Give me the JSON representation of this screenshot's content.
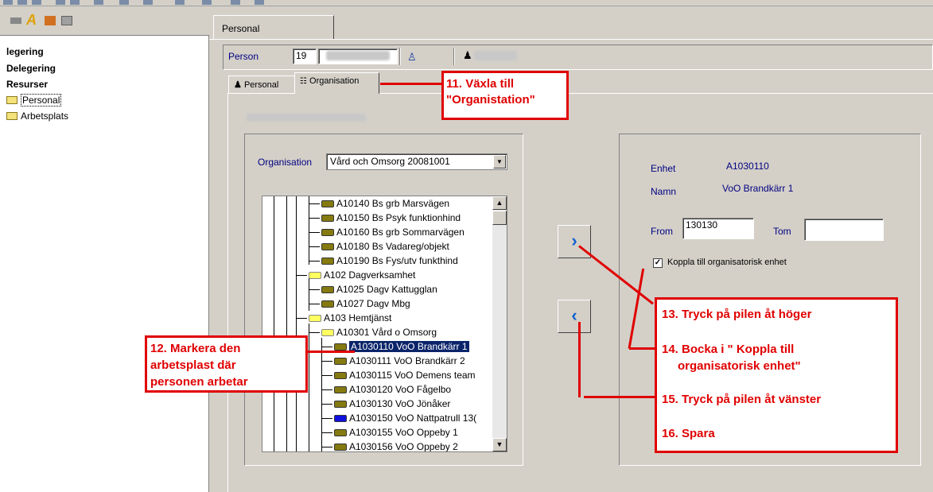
{
  "left_tree": {
    "items": [
      {
        "label": "legering",
        "bold": true
      },
      {
        "label": "Delegering",
        "bold": true
      },
      {
        "label": "Resurser",
        "bold": true
      },
      {
        "label": "Personal",
        "folder": true
      },
      {
        "label": "Arbetsplats",
        "folder": true
      }
    ]
  },
  "top_tab": {
    "label": "Personal"
  },
  "person": {
    "label": "Person",
    "id_prefix": "19"
  },
  "inner_tabs": {
    "personal": "Personal",
    "organisation": "Organisation"
  },
  "org": {
    "label": "Organisation",
    "selected": "Vård och Omsorg 20081001"
  },
  "tree": [
    {
      "code": "A10140",
      "name": "Bs grb Marsvägen",
      "icon": "olive"
    },
    {
      "code": "A10150",
      "name": "Bs Psyk funktionhind",
      "icon": "olive"
    },
    {
      "code": "A10160",
      "name": "Bs grb Sommarvägen",
      "icon": "olive"
    },
    {
      "code": "A10180",
      "name": "Bs Vadareg/objekt",
      "icon": "olive"
    },
    {
      "code": "A10190",
      "name": "Bs Fys/utv funkthind",
      "icon": "olive"
    },
    {
      "code": "A102",
      "name": "Dagverksamhet",
      "icon": "yellow"
    },
    {
      "code": "A1025",
      "name": "Dagv Kattugglan",
      "icon": "olive"
    },
    {
      "code": "A1027",
      "name": "Dagv Mbg",
      "icon": "olive"
    },
    {
      "code": "A103",
      "name": "Hemtjänst",
      "icon": "yellow"
    },
    {
      "code": "A10301",
      "name": "Vård o Omsorg",
      "icon": "yellow"
    },
    {
      "code": "A1030110",
      "name": "VoO Brandkärr 1",
      "icon": "olive",
      "selected": true
    },
    {
      "code": "A1030111",
      "name": "VoO Brandkärr 2",
      "icon": "olive"
    },
    {
      "code": "A1030115",
      "name": "VoO Demens team",
      "icon": "olive"
    },
    {
      "code": "A1030120",
      "name": "VoO Fågelbo",
      "icon": "olive"
    },
    {
      "code": "A1030130",
      "name": "VoO Jönåker",
      "icon": "olive"
    },
    {
      "code": "A1030150",
      "name": "VoO Nattpatrull 13(",
      "icon": "blue"
    },
    {
      "code": "A1030155",
      "name": "VoO Oppeby 1",
      "icon": "olive"
    },
    {
      "code": "A1030156",
      "name": "VoO Oppeby 2",
      "icon": "olive"
    }
  ],
  "unit": {
    "enhet_label": "Enhet",
    "enhet_value": "A1030110",
    "namn_label": "Namn",
    "namn_value": "VoO Brandkärr 1",
    "from_label": "From",
    "from_value": "130130",
    "tom_label": "Tom",
    "tom_value": "",
    "checkbox_label": "Koppla till organisatorisk enhet",
    "checked": true
  },
  "callouts": {
    "c11": [
      "11. Växla till",
      "\"Organistation\""
    ],
    "c12": [
      "12. Markera den",
      "arbetsplast där",
      "personen arbetar"
    ],
    "c13": "13. Tryck på pilen åt höger",
    "c14": [
      "14. Bocka i \" Koppla till",
      "organisatorisk enhet\""
    ],
    "c15": "15. Tryck på pilen åt vänster",
    "c16": "16. Spara"
  },
  "colors": {
    "accent_red": "#e00000",
    "selection": "#0a246a",
    "label_blue": "#000080"
  }
}
